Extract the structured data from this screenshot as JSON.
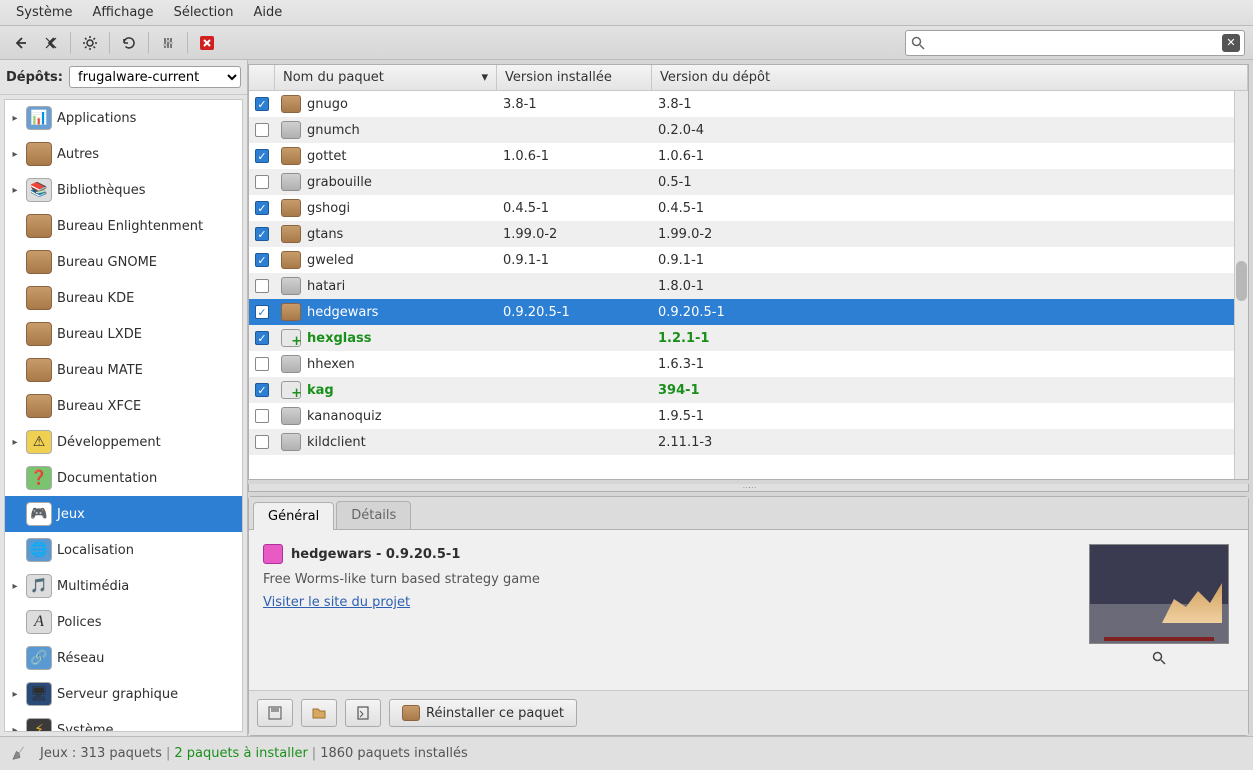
{
  "menu": {
    "items": [
      "Système",
      "Affichage",
      "Sélection",
      "Aide"
    ]
  },
  "depot": {
    "label": "Dépôts:",
    "selected": "frugalware-current"
  },
  "sidebar": {
    "items": [
      {
        "label": "Applications",
        "exp": true,
        "icon": "chart"
      },
      {
        "label": "Autres",
        "exp": true,
        "icon": "box"
      },
      {
        "label": "Bibliothèques",
        "exp": true,
        "icon": "books"
      },
      {
        "label": "Bureau Enlightenment",
        "exp": false,
        "icon": "box"
      },
      {
        "label": "Bureau GNOME",
        "exp": false,
        "icon": "box"
      },
      {
        "label": "Bureau KDE",
        "exp": false,
        "icon": "box"
      },
      {
        "label": "Bureau LXDE",
        "exp": false,
        "icon": "box"
      },
      {
        "label": "Bureau MATE",
        "exp": false,
        "icon": "box"
      },
      {
        "label": "Bureau XFCE",
        "exp": false,
        "icon": "box"
      },
      {
        "label": "Développement",
        "exp": true,
        "icon": "dev"
      },
      {
        "label": "Documentation",
        "exp": false,
        "icon": "doc"
      },
      {
        "label": "Jeux",
        "exp": false,
        "icon": "games",
        "selected": true
      },
      {
        "label": "Localisation",
        "exp": false,
        "icon": "loc"
      },
      {
        "label": "Multimédia",
        "exp": true,
        "icon": "media"
      },
      {
        "label": "Polices",
        "exp": false,
        "icon": "font"
      },
      {
        "label": "Réseau",
        "exp": false,
        "icon": "net"
      },
      {
        "label": "Serveur graphique",
        "exp": true,
        "icon": "screen"
      },
      {
        "label": "Système",
        "exp": true,
        "icon": "sys"
      }
    ]
  },
  "table": {
    "headers": {
      "name": "Nom du paquet",
      "installed": "Version installée",
      "repo": "Version du dépôt"
    },
    "rows": [
      {
        "checked": true,
        "name": "gnugo",
        "installed": "3.8-1",
        "repo": "3.8-1"
      },
      {
        "checked": false,
        "name": "gnumch",
        "installed": "",
        "repo": "0.2.0-4"
      },
      {
        "checked": true,
        "name": "gottet",
        "installed": "1.0.6-1",
        "repo": "1.0.6-1"
      },
      {
        "checked": false,
        "name": "grabouille",
        "installed": "",
        "repo": "0.5-1"
      },
      {
        "checked": true,
        "name": "gshogi",
        "installed": "0.4.5-1",
        "repo": "0.4.5-1"
      },
      {
        "checked": true,
        "name": "gtans",
        "installed": "1.99.0-2",
        "repo": "1.99.0-2"
      },
      {
        "checked": true,
        "name": "gweled",
        "installed": "0.9.1-1",
        "repo": "0.9.1-1"
      },
      {
        "checked": false,
        "name": "hatari",
        "installed": "",
        "repo": "1.8.0-1"
      },
      {
        "checked": true,
        "name": "hedgewars",
        "installed": "0.9.20.5-1",
        "repo": "0.9.20.5-1",
        "selected": true
      },
      {
        "checked": true,
        "name": "hexglass",
        "installed": "",
        "repo": "1.2.1-1",
        "install": true
      },
      {
        "checked": false,
        "name": "hhexen",
        "installed": "",
        "repo": "1.6.3-1"
      },
      {
        "checked": true,
        "name": "kag",
        "installed": "",
        "repo": "394-1",
        "install": true
      },
      {
        "checked": false,
        "name": "kananoquiz",
        "installed": "",
        "repo": "1.9.5-1"
      },
      {
        "checked": false,
        "name": "kildclient",
        "installed": "",
        "repo": "2.11.1-3"
      }
    ]
  },
  "detail": {
    "tabs": {
      "general": "Général",
      "details": "Détails"
    },
    "title": "hedgewars - 0.9.20.5-1",
    "desc": "Free Worms-like turn based strategy game",
    "link": "Visiter le site du projet",
    "reinstall": "Réinstaller ce paquet"
  },
  "status": {
    "category": "Jeux : 313 paquets",
    "pending": "2 paquets à installer",
    "installed": "1860 paquets installés"
  },
  "search": {
    "placeholder": ""
  }
}
